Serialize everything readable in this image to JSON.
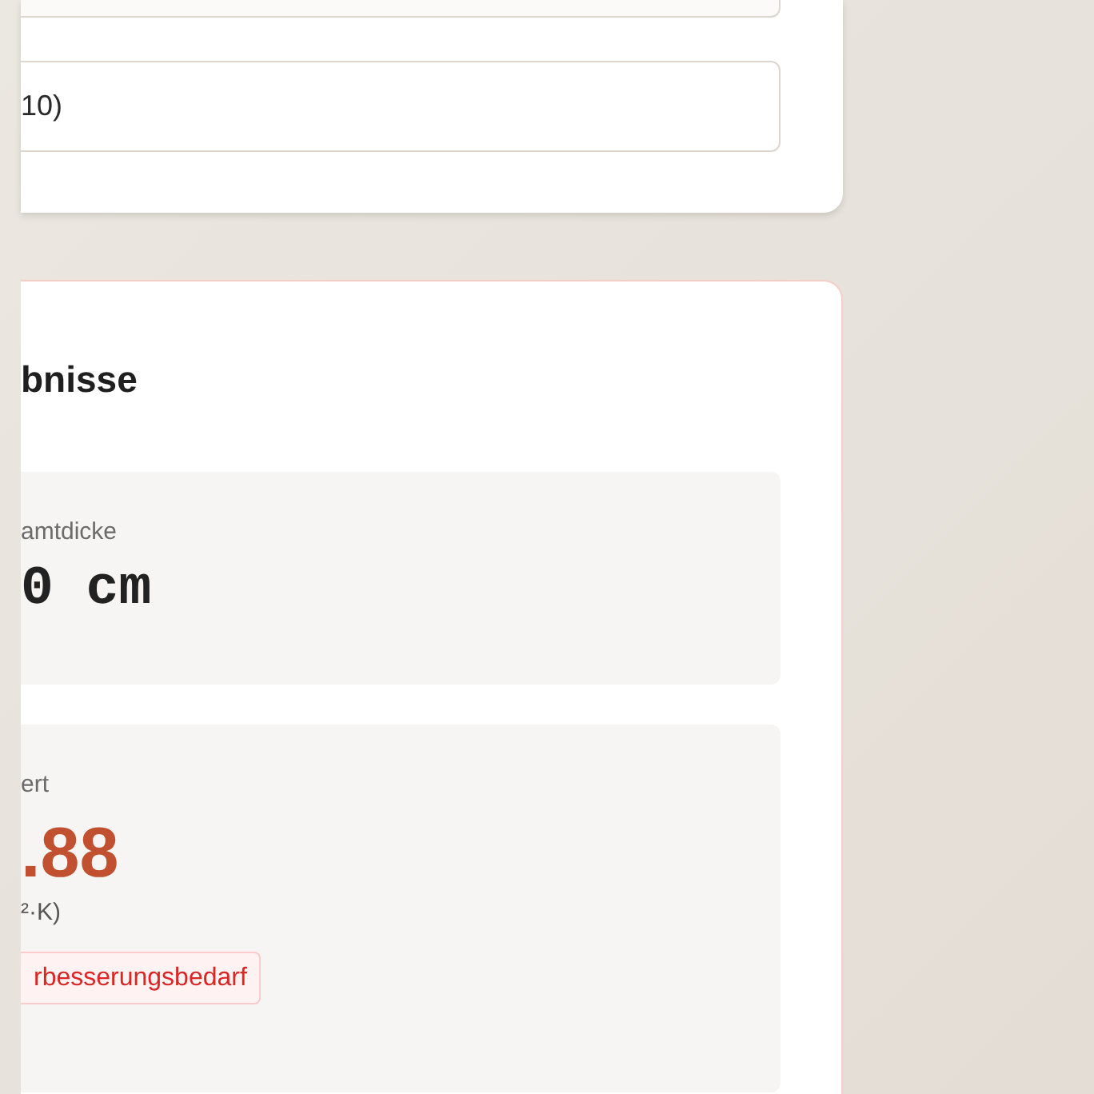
{
  "settings_card": {
    "field_value": "10)"
  },
  "results_card": {
    "heading": "bnisse",
    "metrics": [
      {
        "kind": "plain",
        "label": "amtdicke",
        "value": "0 cm"
      },
      {
        "kind": "rated",
        "label": "ert",
        "value": ".88",
        "unit": "²·K)",
        "badge": "rbesserungsbedarf"
      }
    ]
  }
}
